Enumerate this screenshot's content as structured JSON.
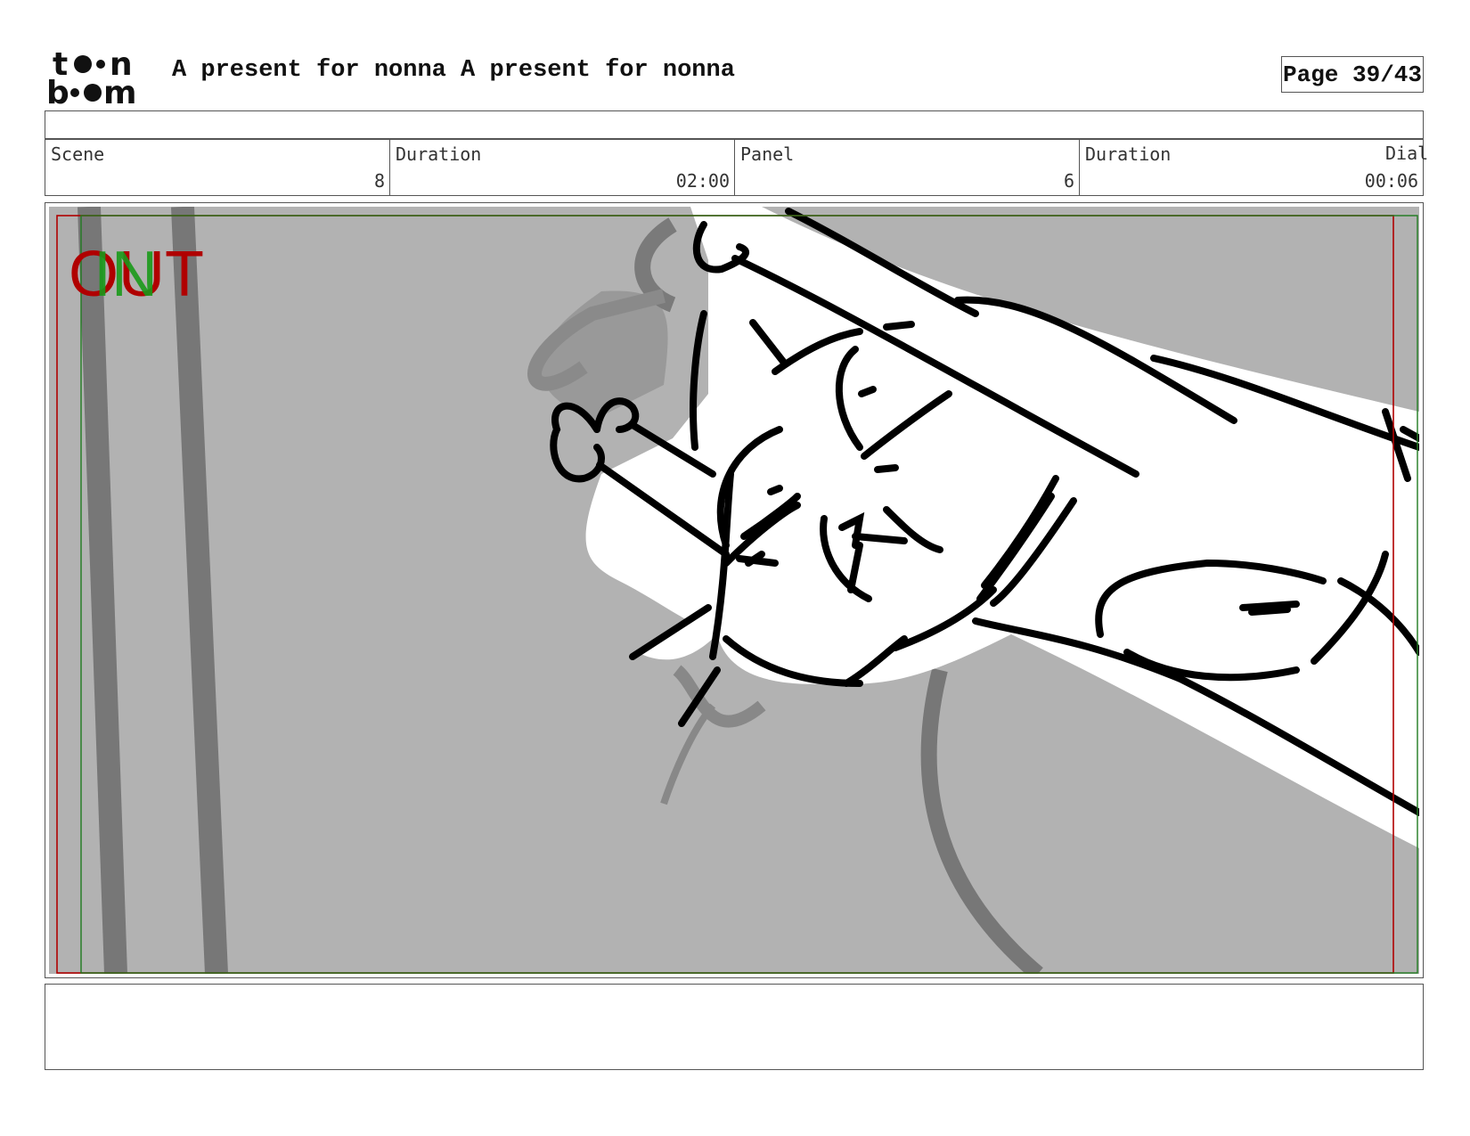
{
  "header": {
    "logo_text": "toon boom",
    "title": "A present for nonna  A present for nonna",
    "page_label": "Page 39/43"
  },
  "info": {
    "scene_label": "Scene",
    "scene_value": "8",
    "scene_duration_label": "Duration",
    "scene_duration_value": "02:00",
    "panel_label": "Panel",
    "panel_value": "6",
    "panel_duration_label": "Duration",
    "panel_duration_value": "00:06",
    "dialog_label": "Dial"
  },
  "panel": {
    "out_marker": "OUT",
    "in_marker": "IN",
    "colors": {
      "out": "#b00000",
      "in": "#1a9a1a",
      "bg": "#b2b2b2"
    }
  },
  "notes": {
    "text": ""
  }
}
